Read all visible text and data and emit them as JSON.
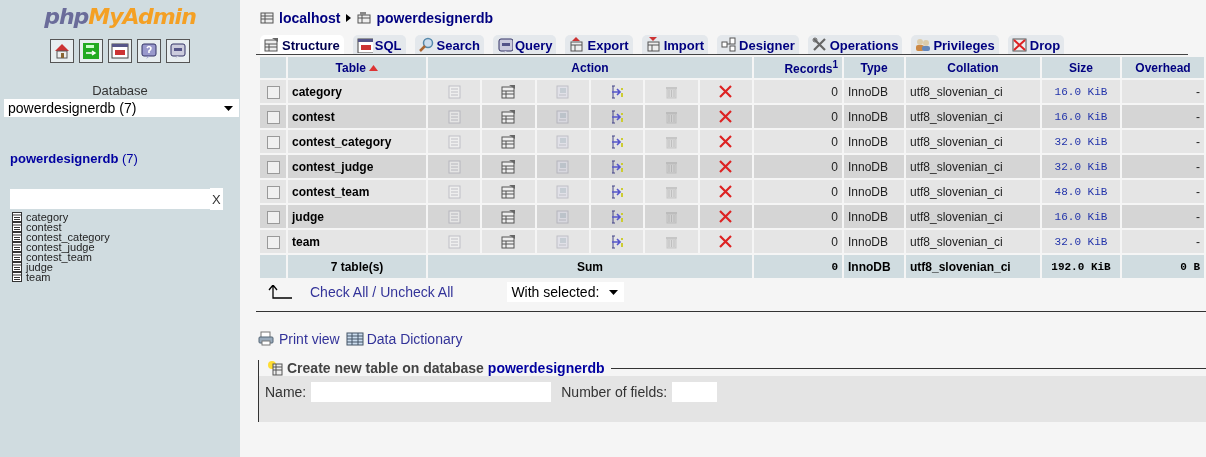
{
  "sidebar": {
    "logo": {
      "prefix": "php",
      "name": "MyAdmin"
    },
    "database_label": "Database",
    "database_select": "powerdesignerdb (7)",
    "db_title": {
      "name": "powerdesignerdb",
      "count": "(7)"
    },
    "filter": {
      "clear": "X"
    },
    "tables": [
      "category",
      "contest",
      "contest_category",
      "contest_judge",
      "contest_team",
      "judge",
      "team"
    ]
  },
  "breadcrumb": {
    "server": "localhost",
    "database": "powerdesignerdb"
  },
  "tabs": [
    {
      "label": "Structure",
      "selected": true
    },
    {
      "label": "SQL",
      "selected": false
    },
    {
      "label": "Search",
      "selected": false
    },
    {
      "label": "Query",
      "selected": false
    },
    {
      "label": "Export",
      "selected": false
    },
    {
      "label": "Import",
      "selected": false
    },
    {
      "label": "Designer",
      "selected": false
    },
    {
      "label": "Operations",
      "selected": false
    },
    {
      "label": "Privileges",
      "selected": false
    },
    {
      "label": "Drop",
      "selected": false
    }
  ],
  "table": {
    "columns": [
      "Table",
      "Action",
      "Records$^{1}$",
      "Type",
      "Collation",
      "Size",
      "Overhead"
    ],
    "rows": [
      {
        "checked": false,
        "name": "category",
        "records": "0",
        "type": "InnoDB",
        "collation": "utf8_slovenian_ci",
        "size": "16.0 KiB",
        "overhead": "-"
      },
      {
        "checked": false,
        "name": "contest",
        "records": "0",
        "type": "InnoDB",
        "collation": "utf8_slovenian_ci",
        "size": "16.0 KiB",
        "overhead": "-"
      },
      {
        "checked": false,
        "name": "contest_category",
        "records": "0",
        "type": "InnoDB",
        "collation": "utf8_slovenian_ci",
        "size": "32.0 KiB",
        "overhead": "-"
      },
      {
        "checked": false,
        "name": "contest_judge",
        "records": "0",
        "type": "InnoDB",
        "collation": "utf8_slovenian_ci",
        "size": "32.0 KiB",
        "overhead": "-"
      },
      {
        "checked": false,
        "name": "contest_team",
        "records": "0",
        "type": "InnoDB",
        "collation": "utf8_slovenian_ci",
        "size": "48.0 KiB",
        "overhead": "-"
      },
      {
        "checked": false,
        "name": "judge",
        "records": "0",
        "type": "InnoDB",
        "collation": "utf8_slovenian_ci",
        "size": "16.0 KiB",
        "overhead": "-"
      },
      {
        "checked": false,
        "name": "team",
        "records": "0",
        "type": "InnoDB",
        "collation": "utf8_slovenian_ci",
        "size": "32.0 KiB",
        "overhead": "-"
      }
    ],
    "actions": [
      {
        "kind": "browse",
        "disabled": true
      },
      {
        "kind": "structure",
        "disabled": false
      },
      {
        "kind": "search",
        "disabled": true
      },
      {
        "kind": "insert",
        "disabled": false
      },
      {
        "kind": "empty",
        "disabled": true
      },
      {
        "kind": "drop",
        "disabled": false
      }
    ],
    "summary": {
      "count": "7 table(s)",
      "label": "Sum",
      "records": "0",
      "type": "InnoDB",
      "collation": "utf8_slovenian_ci",
      "size": "192.0 KiB",
      "overhead": "0 B"
    }
  },
  "bulk": {
    "check_all": "Check All",
    "separator": "/",
    "uncheck_all": "Uncheck All",
    "with_selected": "With selected:"
  },
  "links": [
    "Print view",
    "Data Dictionary"
  ],
  "create_table": {
    "legend": "Create new table on database",
    "database": "powerdesignerdb",
    "name_label": "Name:",
    "fields_label": "Number of fields:"
  }
}
